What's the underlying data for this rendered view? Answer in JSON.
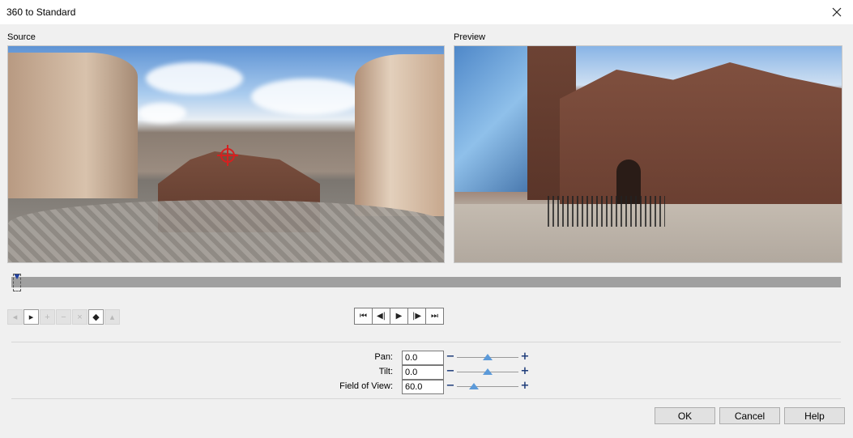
{
  "window": {
    "title": "360 to Standard",
    "close_icon": "close-icon"
  },
  "source": {
    "label": "Source"
  },
  "preview": {
    "label": "Preview"
  },
  "timeline": {
    "position": 0.0
  },
  "keyframe_toolbar": [
    {
      "name": "first-keyframe",
      "icon": "prev-keyframe-icon",
      "enabled": false
    },
    {
      "name": "next-keyframe",
      "icon": "next-keyframe-icon",
      "enabled": true
    },
    {
      "name": "add-keyframe",
      "icon": "add-keyframe-icon",
      "enabled": false
    },
    {
      "name": "remove-keyframe",
      "icon": "remove-keyframe-icon",
      "enabled": false
    },
    {
      "name": "delete-keyframe",
      "icon": "delete-keyframe-icon",
      "enabled": false
    },
    {
      "name": "keyframe-settings",
      "icon": "keyframe-settings-icon",
      "enabled": true
    },
    {
      "name": "paste-keyframe",
      "icon": "paste-keyframe-icon",
      "enabled": false
    }
  ],
  "transport": [
    {
      "name": "go-to-start",
      "icon": "go-to-start-icon",
      "glyph": "⏮"
    },
    {
      "name": "step-back",
      "icon": "step-back-icon",
      "glyph": "◀|"
    },
    {
      "name": "play",
      "icon": "play-icon",
      "glyph": "▶"
    },
    {
      "name": "step-forward",
      "icon": "step-forward-icon",
      "glyph": "|▶"
    },
    {
      "name": "go-to-end",
      "icon": "go-to-end-icon",
      "glyph": "⏭"
    }
  ],
  "params": {
    "pan": {
      "label": "Pan:",
      "value": "0.0",
      "slider_fraction": 0.5
    },
    "tilt": {
      "label": "Tilt:",
      "value": "0.0",
      "slider_fraction": 0.5
    },
    "fov": {
      "label": "Field of View:",
      "value": "60.0",
      "slider_fraction": 0.27
    },
    "minus_glyph": "−",
    "plus_glyph": "+"
  },
  "buttons": {
    "ok": "OK",
    "cancel": "Cancel",
    "help": "Help"
  },
  "colors": {
    "slider_thumb": "#5c9ad9",
    "stepper": "#1f3d7a",
    "source_marker": "#d62020"
  }
}
